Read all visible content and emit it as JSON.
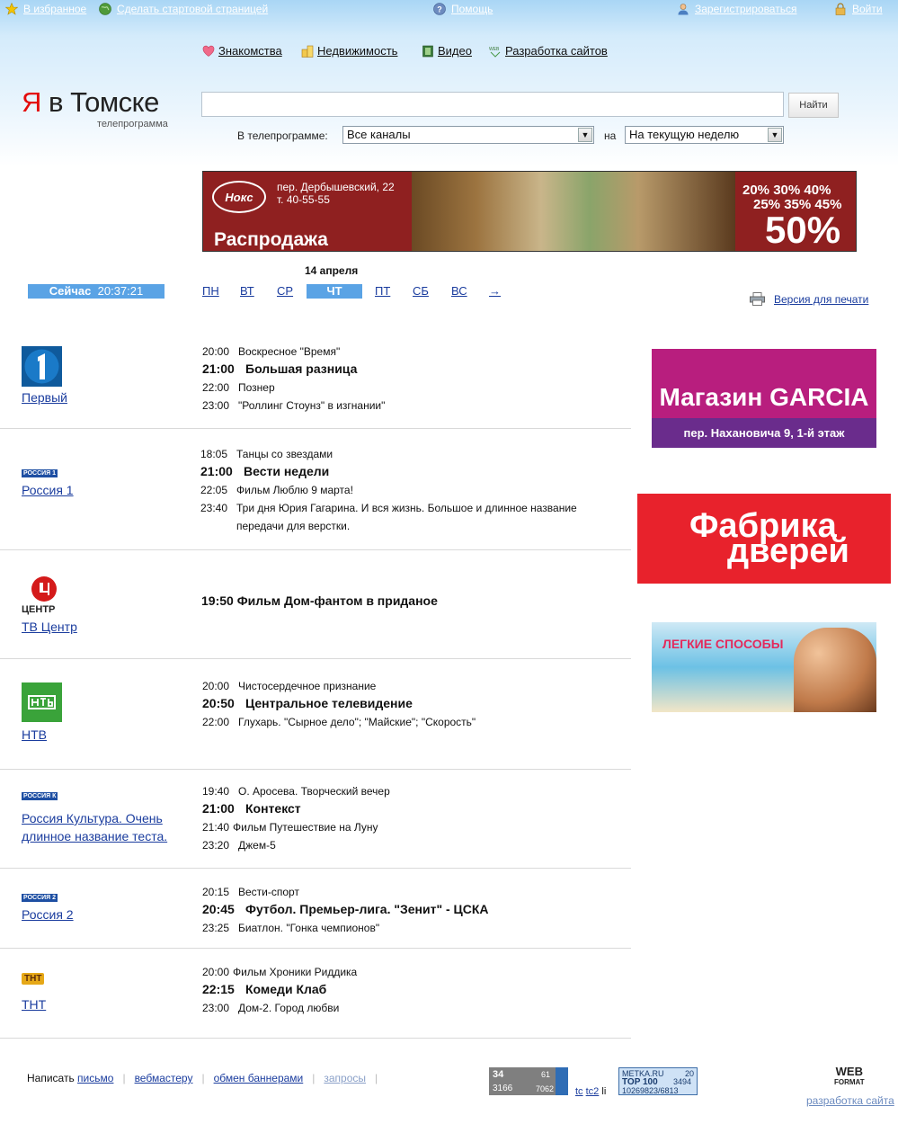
{
  "topbar": {
    "favorites": "В избранное",
    "homepage": "Сделать стартовой страницей",
    "help": "Помощь",
    "register": "Зарегистрироваться",
    "login": "Войти"
  },
  "services": [
    {
      "label": "Знакомства",
      "icon": "heart-icon"
    },
    {
      "label": "Недвижимость",
      "icon": "buildings-icon"
    },
    {
      "label": "Видео",
      "icon": "film-icon"
    },
    {
      "label": "Разработка сайтов",
      "icon": "web-icon"
    }
  ],
  "logo": {
    "ya": "Я",
    "rest": " в Томске",
    "subtitle": "телепрограмма"
  },
  "search": {
    "placeholder": "",
    "button": "Найти"
  },
  "filter": {
    "label": "В телепрограмме:",
    "channels_value": "Все каналы",
    "on_label": "на",
    "period_value": "На текущую неделю"
  },
  "top_banner": {
    "logo": "Нокс",
    "address": "пер. Дербышевский, 22",
    "phone": "т. 40-55-55",
    "sale": "Распродажа",
    "percents_line1": "20% 30% 40%",
    "percents_line2": "25% 35% 45%",
    "percents_big": "50%"
  },
  "schedule_nav": {
    "date": "14 апреля",
    "now_label": "Сейчас",
    "now_time": "20:37:21",
    "days": [
      "ПН",
      "ВТ",
      "СР",
      "ЧТ",
      "ПТ",
      "СБ",
      "ВС",
      "→"
    ],
    "active_day_index": 3,
    "print": "Версия для печати"
  },
  "channels": [
    {
      "name": "Первый",
      "programs": [
        {
          "time": "20:00",
          "title": "Воскресное \"Время\"",
          "main": false
        },
        {
          "time": "21:00",
          "title": "Большая разница",
          "main": true
        },
        {
          "time": "22:00",
          "title": "Познер",
          "main": false
        },
        {
          "time": "23:00",
          "title": "\"Роллинг Стоунз\" в изгнании\"",
          "main": false
        }
      ]
    },
    {
      "name": "Россия 1",
      "programs": [
        {
          "time": "18:05",
          "title": "Танцы со звездами",
          "main": false
        },
        {
          "time": "21:00",
          "title": "Вести недели",
          "main": true
        },
        {
          "time": "22:05",
          "title": "Фильм  Люблю 9 марта!",
          "main": false
        },
        {
          "time": "23:40",
          "title": "Три дня Юрия Гагарина. И вся жизнь. Большое и длинное название",
          "title2": "передачи для верстки.",
          "main": false
        }
      ]
    },
    {
      "name": "ТВ Центр",
      "programs": [
        {
          "time": "19:50",
          "title": "Фильм  Дом-фантом в приданое",
          "main": true
        }
      ]
    },
    {
      "name": "НТВ",
      "programs": [
        {
          "time": "20:00",
          "title": "Чистосердечное признание",
          "main": false
        },
        {
          "time": "20:50",
          "title": "Центральное телевидение",
          "main": true
        },
        {
          "time": "22:00",
          "title": "Глухарь. \"Сырное дело\"; \"Майские\"; \"Скорость\"",
          "main": false
        }
      ]
    },
    {
      "name": "Россия Культура. Очень",
      "name2": "длинное название теста.",
      "programs": [
        {
          "time": "19:40",
          "title": "О. Аросева. Творческий вечер",
          "main": false
        },
        {
          "time": "21:00",
          "title": "Контекст",
          "main": true
        },
        {
          "time": "21:40",
          "title": "Фильм  Путешествие на Луну",
          "main": false
        },
        {
          "time": "23:20",
          "title": "Джем-5",
          "main": false
        }
      ]
    },
    {
      "name": "Россия 2",
      "programs": [
        {
          "time": "20:15",
          "title": "Вести-спорт",
          "main": false
        },
        {
          "time": "20:45",
          "title": "Футбол. Премьер-лига. \"Зенит\" - ЦСКА",
          "main": true
        },
        {
          "time": "23:25",
          "title": "Биатлон. \"Гонка чемпионов\"",
          "main": false
        }
      ]
    },
    {
      "name": "ТНТ",
      "programs": [
        {
          "time": "20:00",
          "title": "Фильм  Хроники Риддика",
          "main": false
        },
        {
          "time": "22:15",
          "title": "Комеди Клаб",
          "main": true
        },
        {
          "time": "23:00",
          "title": "Дом-2. Город любви",
          "main": false
        }
      ]
    }
  ],
  "channel_logo_text": {
    "russia1": "РОССИЯ 1",
    "tvc": "ЦЕНТР",
    "kultura": "РОССИЯ К",
    "russia2": "РОССИЯ 2",
    "tnt": "ТНТ"
  },
  "right_banners": {
    "garcia_title": "Магазин GARCIA",
    "garcia_address": "пер. Нахановича 9, 1-й этаж",
    "doors_line1": "Фабрика",
    "doors_line2": "дверей",
    "easy": "ЛЕГКИЕ СПОСОБЫ"
  },
  "footer": {
    "write": "Написать",
    "letter": "письмо",
    "webmaster": "вебмастеру",
    "banners": "обмен баннерами",
    "requests": "запросы",
    "counter1": {
      "a": "34",
      "b": "61",
      "c": "3166",
      "d": "7062"
    },
    "tc": "tc",
    "tc2": "tc2",
    "li": "li",
    "counter2": {
      "brand": "METKA.RU",
      "n": "20",
      "top": "TOP 100",
      "top_val": "3494",
      "total": "10269823/6813"
    },
    "webformat": "WEB",
    "webformat_sub": "FORMAT",
    "devsite": "разработка сайта"
  }
}
